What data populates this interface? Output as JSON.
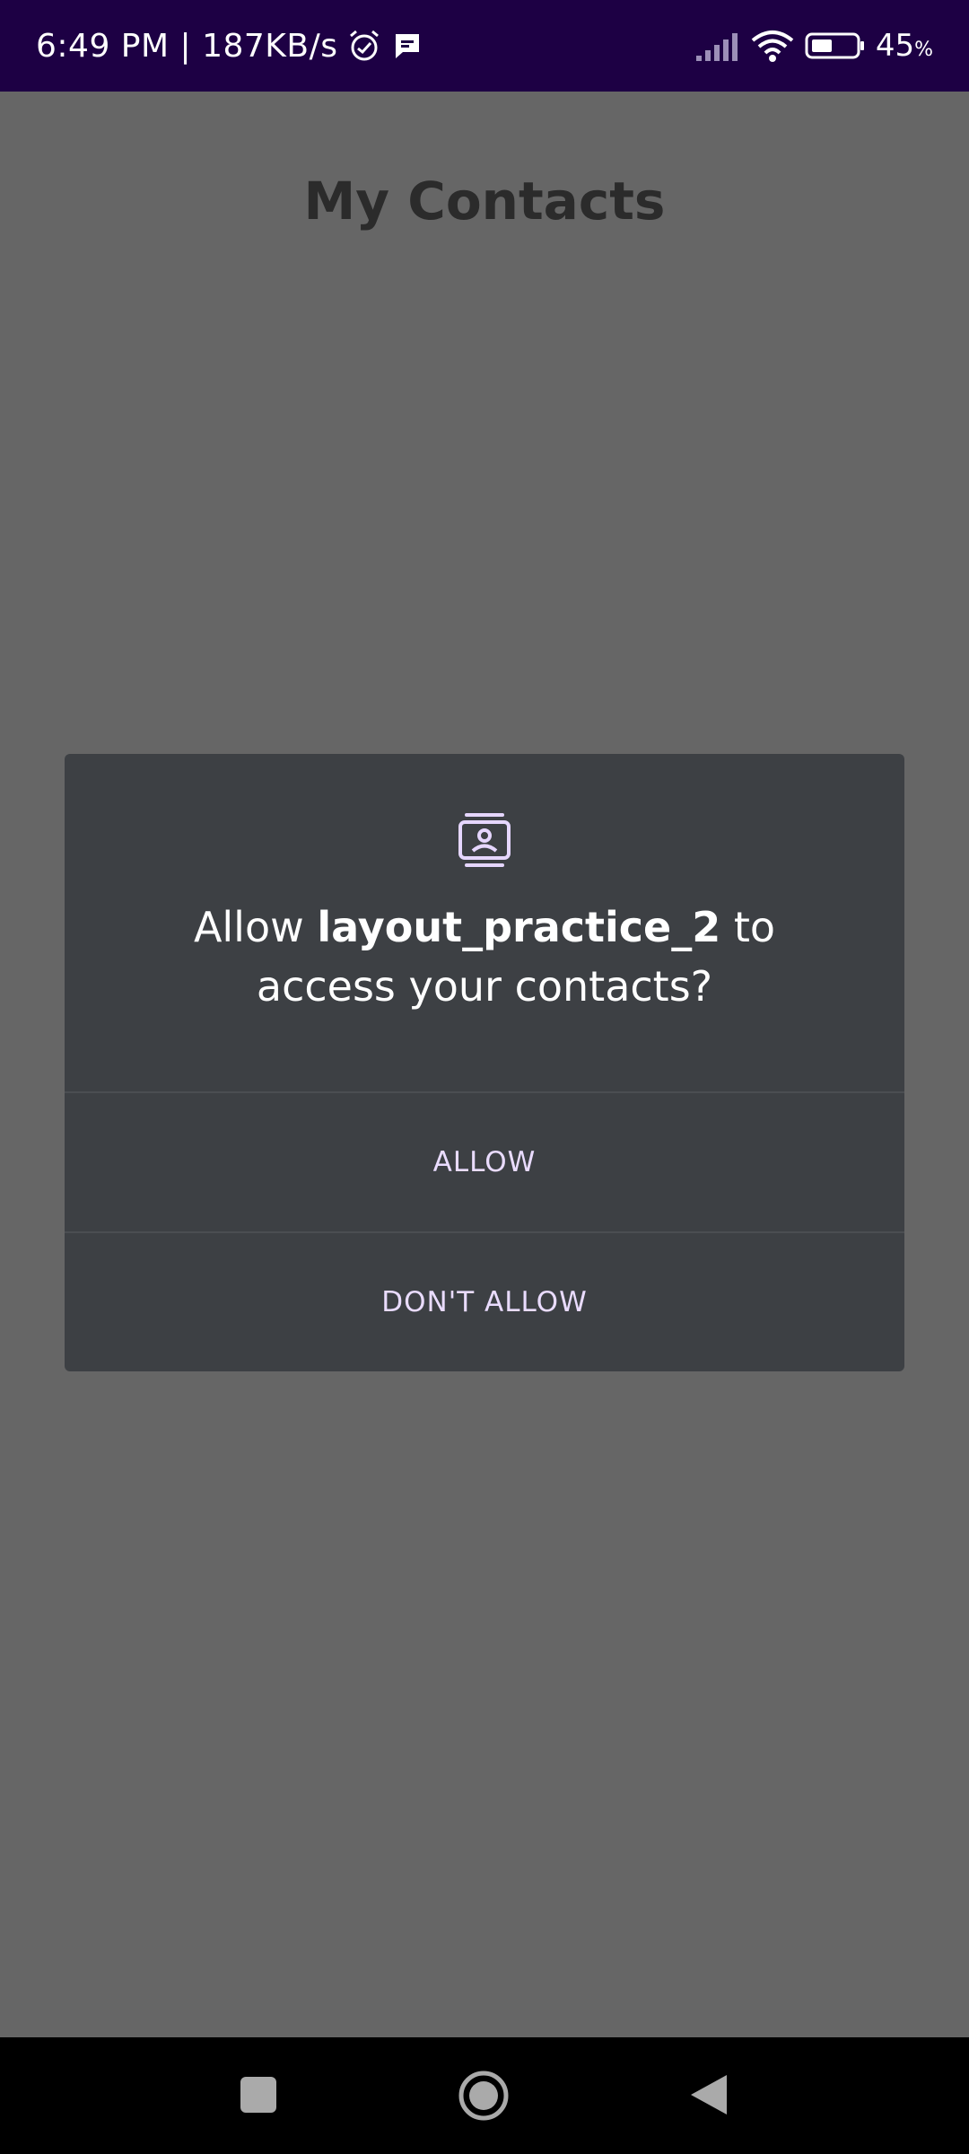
{
  "status_bar": {
    "time_speed": "6:49 PM | 187KB/s",
    "icons": [
      "alarm-icon",
      "message-icon",
      "signal-icon",
      "wifi-icon",
      "battery-icon"
    ],
    "battery_value": "45",
    "battery_unit": "%"
  },
  "app": {
    "title": "My Contacts"
  },
  "dialog": {
    "icon": "contacts-icon",
    "message_prefix": "Allow ",
    "app_name": "layout_practice_2",
    "message_suffix": " to access your contacts?",
    "allow_label": "ALLOW",
    "deny_label": "DON'T ALLOW"
  },
  "nav_bar": {
    "icons": [
      "recents-icon",
      "home-icon",
      "back-icon"
    ]
  },
  "colors": {
    "status_bar_bg": "#1d0044",
    "scrim_bg": "#666666",
    "dialog_bg": "#3d4044",
    "button_text": "#eadcff",
    "icon_accent": "#e6d6ff"
  }
}
